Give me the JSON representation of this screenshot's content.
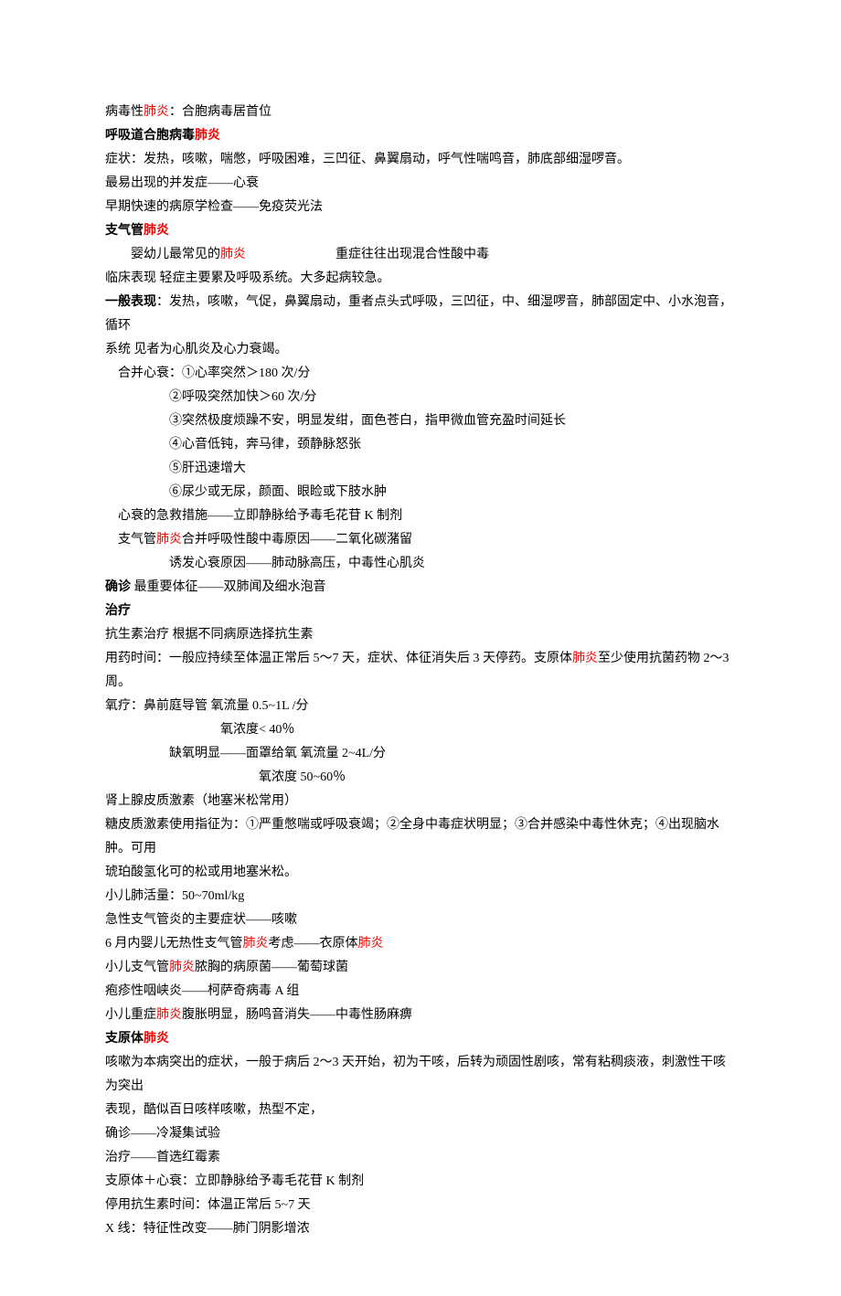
{
  "lines": [
    {
      "name": "line-01",
      "parts": [
        {
          "t": "病毒性",
          "c": ""
        },
        {
          "t": "肺炎",
          "c": "red"
        },
        {
          "t": "：合胞病毒居首位",
          "c": ""
        }
      ]
    },
    {
      "name": "line-02",
      "cls": "bold",
      "parts": [
        {
          "t": "呼吸道合胞病毒",
          "c": ""
        },
        {
          "t": "肺炎",
          "c": "red"
        }
      ]
    },
    {
      "name": "line-03",
      "parts": [
        {
          "t": "症状：发热，咳嗽，喘憋，呼吸困难，三凹征、鼻翼扇动，呼气性喘鸣音，肺底部细湿啰音。",
          "c": ""
        }
      ]
    },
    {
      "name": "line-04",
      "parts": [
        {
          "t": "最易出现的并发症——心衰",
          "c": ""
        }
      ]
    },
    {
      "name": "line-05",
      "parts": [
        {
          "t": "早期快速的病原学检查——免疫荧光法",
          "c": ""
        }
      ]
    },
    {
      "name": "line-06",
      "cls": "bold",
      "parts": [
        {
          "t": "支气管",
          "c": ""
        },
        {
          "t": "肺炎",
          "c": "red"
        }
      ]
    },
    {
      "name": "line-07",
      "cls": "indent2",
      "parts": [
        {
          "t": "婴幼儿最常见的",
          "c": ""
        },
        {
          "t": "肺炎",
          "c": "red"
        },
        {
          "gap": true
        },
        {
          "t": "重症往往出现混合性酸中毒",
          "c": ""
        }
      ]
    },
    {
      "name": "line-08",
      "parts": [
        {
          "t": "临床表现  轻症主要累及呼吸系统。大多起病较急。",
          "c": ""
        }
      ]
    },
    {
      "name": "line-09",
      "parts": [
        {
          "t": "  一般表现",
          "c": "bold"
        },
        {
          "t": "：发热，咳嗽，气促，鼻翼扇动，重者点头式呼吸，三凹征，中、细湿啰音，肺部固定中、小水泡音，循环",
          "c": ""
        }
      ]
    },
    {
      "name": "line-10",
      "parts": [
        {
          "t": "系统   见者为心肌炎及心力衰竭。",
          "c": ""
        }
      ]
    },
    {
      "name": "line-11",
      "cls": "indent1",
      "parts": [
        {
          "t": "合并心衰：①心率突然＞180 次/分",
          "c": ""
        }
      ]
    },
    {
      "name": "line-12",
      "cls": "indent3",
      "parts": [
        {
          "t": "②呼吸突然加快＞60 次/分",
          "c": ""
        }
      ]
    },
    {
      "name": "line-13",
      "cls": "indent3",
      "parts": [
        {
          "t": "③突然极度烦躁不安，明显发绀，面色苍白，指甲微血管充盈时间延长",
          "c": ""
        }
      ]
    },
    {
      "name": "line-14",
      "cls": "indent3",
      "parts": [
        {
          "t": "④心音低钝，奔马律，颈静脉怒张",
          "c": ""
        }
      ]
    },
    {
      "name": "line-15",
      "cls": "indent3",
      "parts": [
        {
          "t": "⑤肝迅速增大",
          "c": ""
        }
      ]
    },
    {
      "name": "line-16",
      "cls": "indent3",
      "parts": [
        {
          "t": "⑥尿少或无尿，颜面、眼睑或下肢水肿",
          "c": ""
        }
      ]
    },
    {
      "name": "line-17",
      "cls": "indent1",
      "parts": [
        {
          "t": "心衰的急救措施——立即静脉给予毒毛花苷 K 制剂",
          "c": ""
        }
      ]
    },
    {
      "name": "line-18",
      "cls": "indent1",
      "parts": [
        {
          "t": "支气管",
          "c": ""
        },
        {
          "t": "肺炎",
          "c": "red"
        },
        {
          "t": "合并呼吸性酸中毒原因——二氧化碳潴留",
          "c": ""
        }
      ]
    },
    {
      "name": "line-19",
      "cls": "indent3",
      "parts": [
        {
          "t": "诱发心衰原因——肺动脉高压，中毒性心肌炎",
          "c": ""
        }
      ]
    },
    {
      "name": "line-20",
      "parts": [
        {
          "t": "确诊",
          "c": "bold"
        },
        {
          "t": " 最重要体征——双肺闻及细水泡音",
          "c": ""
        }
      ]
    },
    {
      "name": "line-21",
      "cls": "bold",
      "parts": [
        {
          "t": "治疗",
          "c": ""
        }
      ]
    },
    {
      "name": "line-22",
      "parts": [
        {
          "t": "抗生素治疗  根据不同病原选择抗生素",
          "c": ""
        }
      ]
    },
    {
      "name": "line-23",
      "parts": [
        {
          "t": "用药时间：一般应持续至体温正常后 5～7 天，症状、体征消失后 3 天停药。支原体",
          "c": ""
        },
        {
          "t": "肺炎",
          "c": "red"
        },
        {
          "t": "至少使用抗菌药物 2～3 周。",
          "c": ""
        }
      ]
    },
    {
      "name": "line-24",
      "parts": [
        {
          "t": "氧疗：鼻前庭导管  氧流量 0.5~1L /分",
          "c": ""
        }
      ]
    },
    {
      "name": "line-25",
      "cls": "indent4",
      "parts": [
        {
          "t": "氧浓度< 40％",
          "c": ""
        }
      ]
    },
    {
      "name": "line-26",
      "cls": "indent3",
      "parts": [
        {
          "t": "缺氧明显——面罩给氧  氧流量 2~4L/分",
          "c": ""
        }
      ]
    },
    {
      "name": "line-27",
      "cls": "indent5",
      "parts": [
        {
          "t": "氧浓度  50~60％",
          "c": ""
        }
      ]
    },
    {
      "name": "line-28",
      "parts": [
        {
          "t": "肾上腺皮质激素（地塞米松常用）",
          "c": ""
        }
      ]
    },
    {
      "name": "line-29",
      "parts": [
        {
          "t": "糖皮质激素使用指征为：①严重憋喘或呼吸衰竭；②全身中毒症状明显；③合并感染中毒性休克；④出现脑水肿。可用",
          "c": ""
        }
      ]
    },
    {
      "name": "line-30",
      "parts": [
        {
          "t": "琥珀酸氢化可的松或用地塞米松。",
          "c": ""
        }
      ]
    },
    {
      "name": "line-31",
      "parts": [
        {
          "t": "小儿肺活量：50~70ml/kg",
          "c": ""
        }
      ]
    },
    {
      "name": "line-32",
      "parts": [
        {
          "t": "急性支气管炎的主要症状——咳嗽",
          "c": ""
        }
      ]
    },
    {
      "name": "line-33",
      "parts": [
        {
          "t": "6 月内婴儿无热性支气管",
          "c": ""
        },
        {
          "t": "肺炎",
          "c": "red"
        },
        {
          "t": "考虑——衣原体",
          "c": ""
        },
        {
          "t": "肺炎",
          "c": "red"
        }
      ]
    },
    {
      "name": "line-34",
      "parts": [
        {
          "t": "小儿支气管",
          "c": ""
        },
        {
          "t": "肺炎",
          "c": "red"
        },
        {
          "t": "脓胸的病原菌——葡萄球菌",
          "c": ""
        }
      ]
    },
    {
      "name": "line-35",
      "parts": [
        {
          "t": "疱疹性咽峡炎——柯萨奇病毒 A 组",
          "c": ""
        }
      ]
    },
    {
      "name": "line-36",
      "parts": [
        {
          "t": "小儿重症",
          "c": ""
        },
        {
          "t": "肺炎",
          "c": "red"
        },
        {
          "t": "腹胀明显，肠鸣音消失——中毒性肠麻痹",
          "c": ""
        }
      ]
    },
    {
      "name": "line-37",
      "cls": "bold",
      "parts": [
        {
          "t": "支原体",
          "c": ""
        },
        {
          "t": "肺炎",
          "c": "red"
        }
      ]
    },
    {
      "name": "line-38",
      "parts": [
        {
          "t": "咳嗽为本病突出的症状，一般于病后 2～3 天开始，初为干咳，后转为顽固性剧咳，常有粘稠痰液，刺激性干咳为突出",
          "c": ""
        }
      ]
    },
    {
      "name": "line-39",
      "parts": [
        {
          "t": "表现，酷似百日咳样咳嗽，热型不定，",
          "c": ""
        }
      ]
    },
    {
      "name": "line-40",
      "parts": [
        {
          "t": "确诊——冷凝集试验",
          "c": ""
        }
      ]
    },
    {
      "name": "line-41",
      "parts": [
        {
          "t": "治疗——首选红霉素",
          "c": ""
        }
      ]
    },
    {
      "name": "line-42",
      "parts": [
        {
          "t": "支原体＋心衰：立即静脉给予毒毛花苷 K 制剂",
          "c": ""
        }
      ]
    },
    {
      "name": "line-43",
      "parts": [
        {
          "t": "停用抗生素时间：体温正常后 5~7 天",
          "c": ""
        }
      ]
    },
    {
      "name": "line-44",
      "parts": [
        {
          "t": "X 线：特征性改变——肺门阴影增浓",
          "c": ""
        }
      ]
    }
  ]
}
